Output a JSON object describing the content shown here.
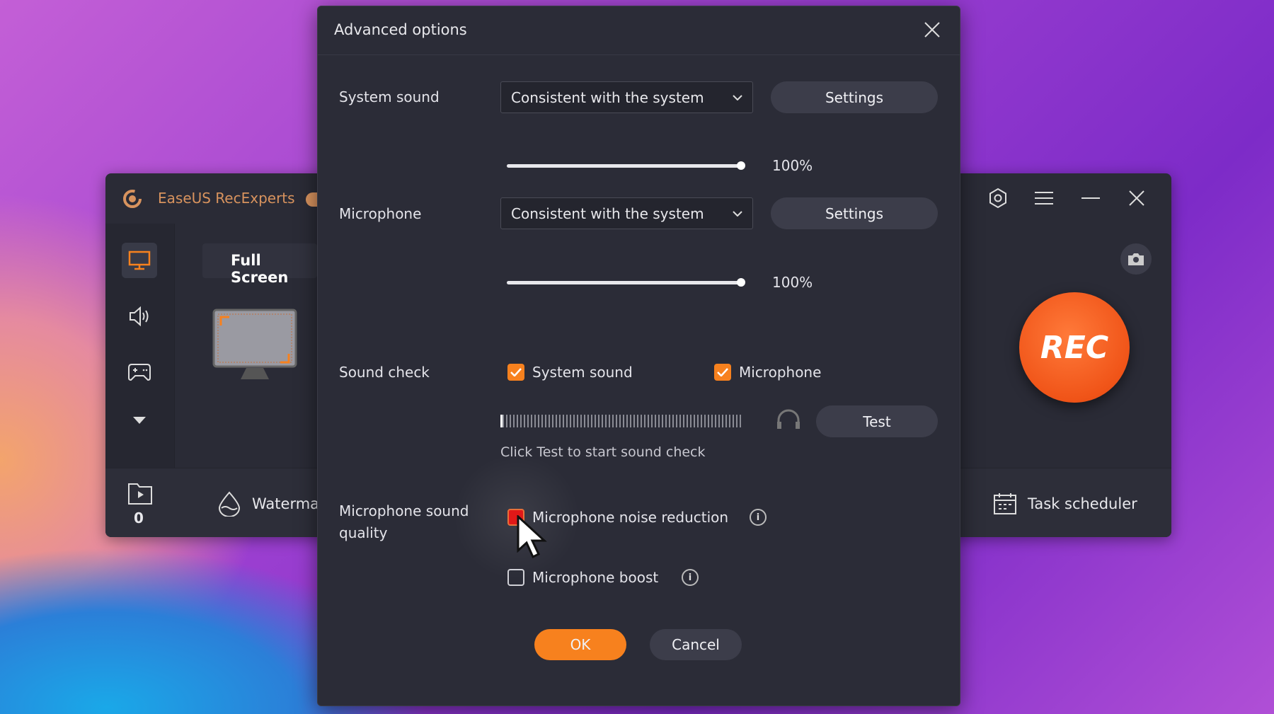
{
  "app": {
    "title": "EaseUS RecExperts",
    "mode_tab": "Full Screen",
    "recordings_count": "0",
    "watermark_label": "Waterma",
    "task_scheduler_label": "Task scheduler",
    "rec_label": "REC",
    "accent": "#f7811e"
  },
  "dialog": {
    "title": "Advanced options",
    "system_sound": {
      "label": "System sound",
      "device": "Consistent with the system",
      "settings_label": "Settings",
      "volume_pct": 100,
      "volume_text": "100%"
    },
    "microphone": {
      "label": "Microphone",
      "device": "Consistent with the system",
      "settings_label": "Settings",
      "volume_pct": 100,
      "volume_text": "100%"
    },
    "sound_check": {
      "label": "Sound check",
      "system_sound_label": "System sound",
      "system_sound_checked": true,
      "microphone_label": "Microphone",
      "microphone_checked": true,
      "test_label": "Test",
      "hint": "Click Test to start sound check"
    },
    "quality": {
      "label_line1": "Microphone sound",
      "label_line2": "quality",
      "noise_reduction_label": "Microphone noise reduction",
      "noise_reduction_checked": false,
      "boost_label": "Microphone boost",
      "boost_checked": false
    },
    "ok_label": "OK",
    "cancel_label": "Cancel"
  }
}
